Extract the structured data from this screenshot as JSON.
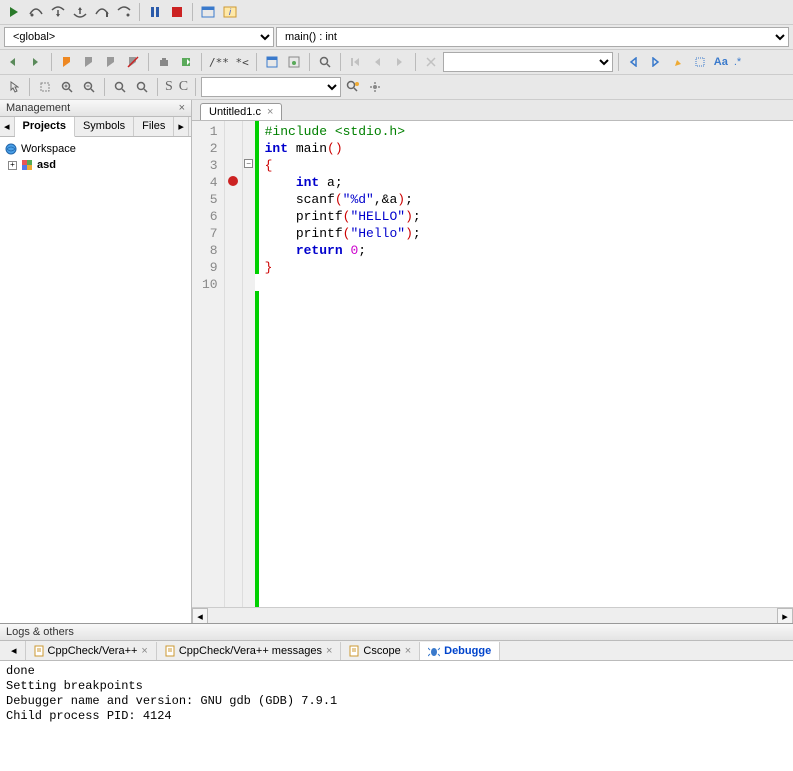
{
  "toolbar2": {
    "scope_combo": "<global>",
    "func_combo": "main() : int"
  },
  "toolbar3": {
    "comment_label": "/** *<"
  },
  "toolbar4": {
    "s_label": "S",
    "c_label": "C"
  },
  "sidebar": {
    "title": "Management",
    "tabs": {
      "projects": "Projects",
      "symbols": "Symbols",
      "files": "Files"
    },
    "tree": {
      "workspace": "Workspace",
      "project": "asd"
    }
  },
  "editor": {
    "tab_name": "Untitled1.c",
    "lines": {
      "l1_include": "#include ",
      "l1_header": "<stdio.h>",
      "l2_kw1": "int",
      "l2_fn": " main",
      "l2_par": "()",
      "l3": "{",
      "l4_kw": "int",
      "l4_rest": " a;",
      "l5_fn": "scanf",
      "l5_p1": "(",
      "l5_str": "\"%d\"",
      "l5_rest": ",&a",
      "l5_p2": ")",
      "l5_semi": ";",
      "l6_fn": "printf",
      "l6_p1": "(",
      "l6_str": "\"HELLO\"",
      "l6_p2": ")",
      "l6_semi": ";",
      "l7_fn": "printf",
      "l7_p1": "(",
      "l7_str": "\"Hello\"",
      "l7_p2": ")",
      "l7_semi": ";",
      "l8_kw": "return",
      "l8_sp": " ",
      "l8_num": "0",
      "l8_semi": ";",
      "l9": "}"
    },
    "line_numbers": [
      "1",
      "2",
      "3",
      "4",
      "5",
      "6",
      "7",
      "8",
      "9",
      "10"
    ]
  },
  "bottom": {
    "title": "Logs & others",
    "tabs": {
      "cppcheck": "CppCheck/Vera++",
      "cppcheck_msg": "CppCheck/Vera++ messages",
      "cscope": "Cscope",
      "debugger": "Debugge"
    },
    "log_lines": [
      "done",
      "Setting breakpoints",
      "Debugger name and version: GNU gdb (GDB) 7.9.1",
      "Child process PID: 4124"
    ]
  }
}
